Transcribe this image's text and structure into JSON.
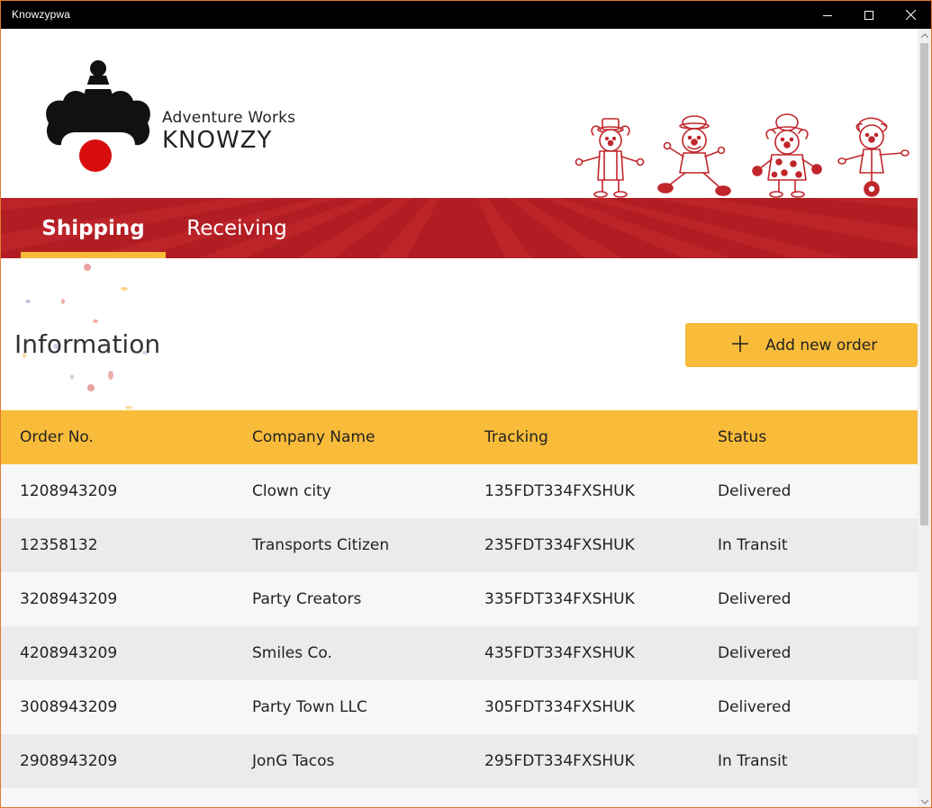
{
  "window": {
    "title": "Knowzypwa"
  },
  "brand": {
    "line1": "Adventure Works",
    "line2": "KNOWZY"
  },
  "nav": {
    "tabs": [
      {
        "label": "Shipping",
        "active": true
      },
      {
        "label": "Receiving",
        "active": false
      }
    ]
  },
  "colors": {
    "accent": "#f8bc3a",
    "nav": "#b01e24",
    "nav_ray": "#c0262c"
  },
  "section": {
    "title": "Information"
  },
  "add_order": {
    "label": "Add new order",
    "icon": "plus-icon"
  },
  "table": {
    "headers": [
      "Order No.",
      "Company Name",
      "Tracking",
      "Status"
    ],
    "rows": [
      [
        "1208943209",
        "Clown city",
        "135FDT334FXSHUK",
        "Delivered"
      ],
      [
        "12358132",
        "Transports Citizen",
        "235FDT334FXSHUK",
        "In Transit"
      ],
      [
        "3208943209",
        "Party Creators",
        "335FDT334FXSHUK",
        "Delivered"
      ],
      [
        "4208943209",
        "Smiles Co.",
        "435FDT334FXSHUK",
        "Delivered"
      ],
      [
        "3008943209",
        "Party Town LLC",
        "305FDT334FXSHUK",
        "Delivered"
      ],
      [
        "2908943209",
        "JonG Tacos",
        "295FDT334FXSHUK",
        "In Transit"
      ]
    ]
  }
}
